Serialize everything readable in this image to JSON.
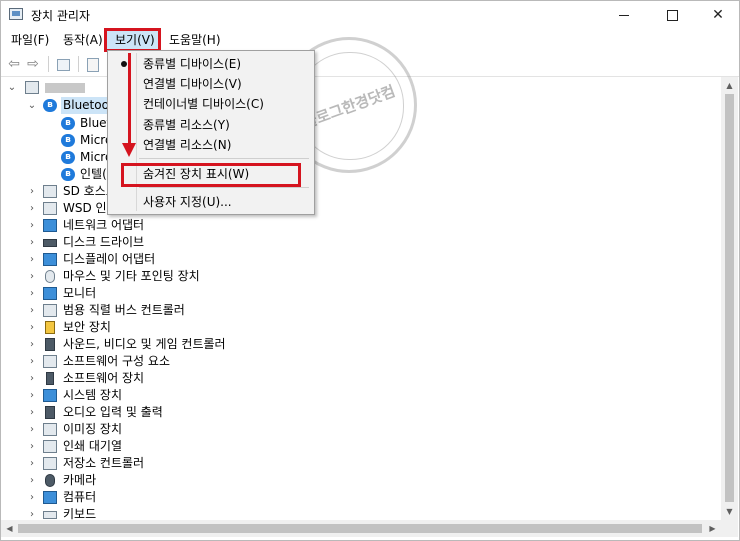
{
  "window": {
    "title": "장치 관리자",
    "min_glyph": "—",
    "max_glyph": "□",
    "close_glyph": "✕"
  },
  "menu": {
    "file": "파일(F)",
    "action": "동작(A)",
    "view": "보기(V)",
    "help": "도움말(H)"
  },
  "toolbar": {
    "back": "⇦",
    "forward": "⇨"
  },
  "tree": {
    "bluetooth": "Bluetooth",
    "bluetooth_children": [
      "Blueto",
      "Micro",
      "Micro",
      "인텔("
    ],
    "categories": [
      "SD 호스트",
      "WSD 인쇄",
      "네트워크 어댑터",
      "디스크 드라이브",
      "디스플레이 어댑터",
      "마우스 및 기타 포인팅 장치",
      "모니터",
      "범용 직렬 버스 컨트롤러",
      "보안 장치",
      "사운드, 비디오 및 게임 컨트롤러",
      "소프트웨어 구성 요소",
      "소프트웨어 장치",
      "시스템 장치",
      "오디오 입력 및 출력",
      "이미징 장치",
      "인쇄 대기열",
      "저장소 컨트롤러",
      "카메라",
      "컴퓨터",
      "키보드"
    ]
  },
  "dropdown": {
    "items": [
      "종류별 디바이스(E)",
      "연결별 디바이스(V)",
      "컨테이너별 디바이스(C)",
      "종류별 리소스(Y)",
      "연결별 리소스(N)"
    ],
    "show_hidden": "숨겨진 장치 표시(W)",
    "customize": "사용자 지정(U)...",
    "selected_index": 0
  },
  "watermark": {
    "text": "블로그한경닷컴"
  },
  "colors": {
    "highlight_red": "#d5141f",
    "selection_blue": "#cce4f7",
    "bluetooth_blue": "#1f7adb"
  }
}
